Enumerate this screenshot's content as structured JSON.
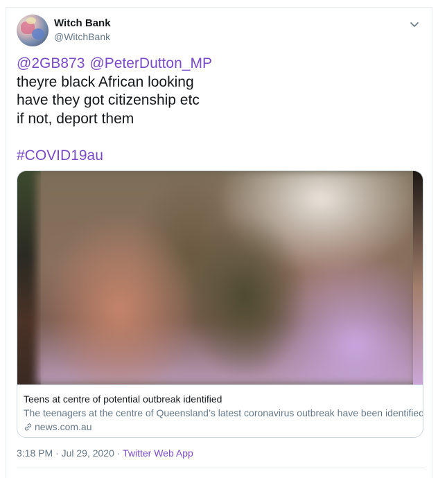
{
  "user": {
    "name": "Witch Bank",
    "handle": "@WitchBank"
  },
  "tweet": {
    "mentions": [
      "@2GB873",
      "@PeterDutton_MP"
    ],
    "lines": [
      "theyre black African looking",
      "have they got citizenship etc",
      "if not, deport them"
    ],
    "hashtag": "#COVID19au"
  },
  "card": {
    "title": "Teens at centre of potential outbreak identified",
    "description": "The teenagers at the centre of Queensland’s latest coronavirus outbreak have been identified.",
    "domain": "news.com.au",
    "image_note": "blurred"
  },
  "footer": {
    "time": "3:18 PM",
    "separator1": " · ",
    "date": "Jul 29, 2020",
    "separator2": " · ",
    "app": "Twitter Web App"
  },
  "colors": {
    "accent": "#794bc4",
    "text": "#14171a",
    "secondary": "#657786",
    "border": "#ccd6dd"
  },
  "icons": {
    "caret": "chevron-down-icon",
    "link": "link-icon"
  }
}
